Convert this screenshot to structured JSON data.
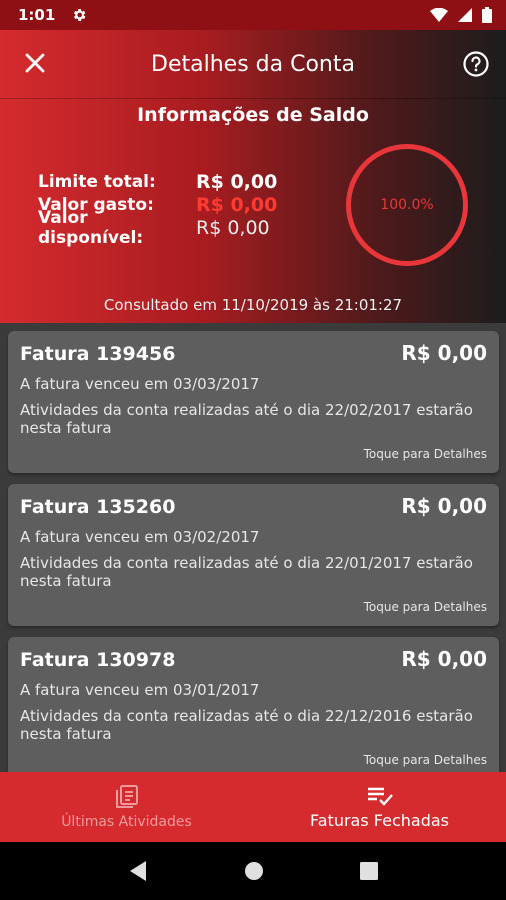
{
  "status_bar": {
    "time": "1:01"
  },
  "toolbar": {
    "title": "Detalhes da Conta"
  },
  "balance": {
    "title": "Informações de Saldo",
    "rows": [
      {
        "label": "Limite total:",
        "value": "R$ 0,00"
      },
      {
        "label": "Valor gasto:",
        "value": "R$ 0,00"
      },
      {
        "label": "Valor disponível:",
        "value": "R$ 0,00"
      }
    ],
    "percent_label": "100.0%",
    "consulted": "Consultado em 11/10/2019 às 21:01:27"
  },
  "invoices": [
    {
      "title": "Fatura 139456",
      "amount": "R$ 0,00",
      "due": "A fatura venceu em 03/03/2017",
      "desc": "Atividades da conta realizadas até o dia 22/02/2017 estarão nesta fatura",
      "tap": "Toque para Detalhes"
    },
    {
      "title": "Fatura 135260",
      "amount": "R$ 0,00",
      "due": "A fatura venceu em 03/02/2017",
      "desc": "Atividades da conta realizadas até o dia 22/01/2017 estarão nesta fatura",
      "tap": "Toque para Detalhes"
    },
    {
      "title": "Fatura 130978",
      "amount": "R$ 0,00",
      "due": "A fatura venceu em 03/01/2017",
      "desc": "Atividades da conta realizadas até o dia 22/12/2016 estarão nesta fatura",
      "tap": "Toque para Detalhes"
    }
  ],
  "bottom_nav": {
    "items": [
      {
        "label": "Últimas Atividades",
        "icon": "documents-icon",
        "active": false
      },
      {
        "label": "Faturas Fechadas",
        "icon": "checklist-icon",
        "active": true
      }
    ]
  },
  "colors": {
    "accent": "#d52b2e",
    "spent": "#ff3b30",
    "card": "#5e5e5e"
  }
}
